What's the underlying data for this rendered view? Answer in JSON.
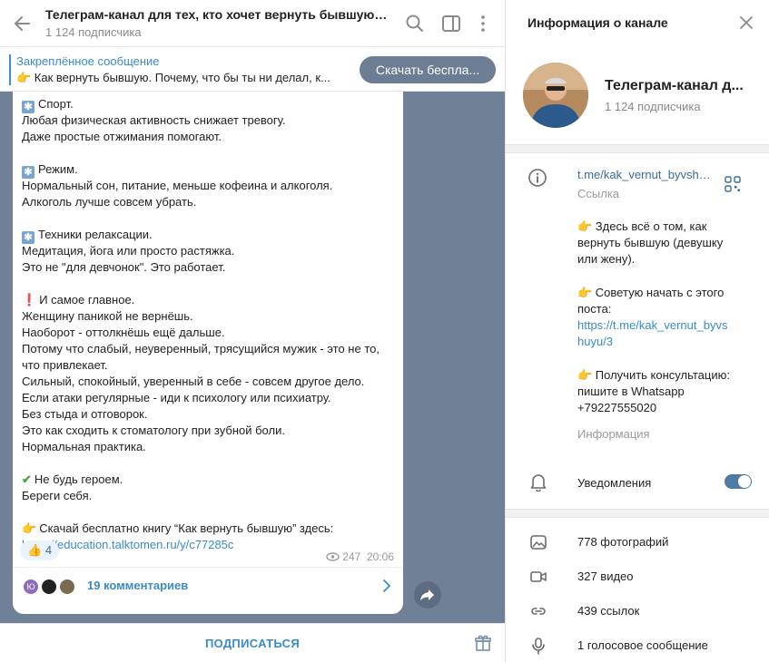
{
  "header": {
    "title": "Телеграм-канал для тех, кто хочет вернуть бывшую | Дм...",
    "subscribers": "1 124 подписчика"
  },
  "pinned": {
    "title": "Закреплённое сообщение",
    "text": "👉 Как вернуть бывшую.  Почему, что бы ты ни делал, к...",
    "button": "Скачать беспла..."
  },
  "message": {
    "lines": [
      {
        "icon": "box",
        "text": "Спорт."
      },
      {
        "text": "Любая физическая активность снижает тревогу."
      },
      {
        "text": "Даже простые отжимания помогают."
      },
      {
        "gap": true
      },
      {
        "icon": "box",
        "text": "Режим."
      },
      {
        "text": "Нормальный сон, питание, меньше кофеина и алкоголя."
      },
      {
        "text": "Алкоголь лучше совсем убрать."
      },
      {
        "gap": true
      },
      {
        "icon": "box",
        "text": "Техники релаксации."
      },
      {
        "text": "Медитация, йога или просто растяжка."
      },
      {
        "text": "Это не \"для девчонок\". Это работает."
      },
      {
        "gap": true
      },
      {
        "icon": "exclaim",
        "text": "И самое главное."
      },
      {
        "text": "Женщину паникой не вернёшь."
      },
      {
        "text": "Наоборот - оттолкнёшь ещё дальше."
      },
      {
        "text": "Потому что слабый, неуверенный, трясущийся мужик - это не то,"
      },
      {
        "text": "что привлекает."
      },
      {
        "text": "Сильный, спокойный, уверенный в себе - совсем другое дело."
      },
      {
        "text": "Если атаки регулярные - иди к психологу или психиатру."
      },
      {
        "text": "Без стыда и отговорок."
      },
      {
        "text": "Это как сходить к стоматологу при зубной боли."
      },
      {
        "text": "Нормальная практика."
      },
      {
        "gap": true
      },
      {
        "icon": "check",
        "text": "Не будь героем."
      },
      {
        "text": "Береги себя."
      },
      {
        "gap": true
      },
      {
        "icon": "hand",
        "text": "Скачай бесплатно книгу “Как вернуть бывшую” здесь:"
      }
    ],
    "link": "https://education.talktomen.ru/y/c77285c",
    "reaction_emoji": "👍",
    "reaction_count": "4",
    "views": "247",
    "time": "20:06",
    "comments": "19 комментариев",
    "avatar_initial": "Ю"
  },
  "bottom": {
    "subscribe": "ПОДПИСАТЬСЯ"
  },
  "right_panel": {
    "title": "Информация о канале",
    "channel_name": "Телеграм-канал д...",
    "subscribers": "1 124 подписчика",
    "link": "t.me/kak_vernut_byvshuyu",
    "link_label": "Ссылка",
    "description": [
      "👉 Здесь всё о том, как",
      "вернуть бывшую (девушку",
      "или жену).",
      "",
      "👉 Советую начать с этого",
      "поста:",
      "https://t.me/kak_vernut_byvs",
      "huyu/3",
      "",
      "👉 Получить консультацию:",
      "пишите в Whatsapp",
      "+79227555020"
    ],
    "description_label": "Информация",
    "notifications": "Уведомления",
    "notifications_on": true,
    "media": [
      {
        "icon": "photo-icon",
        "label": "778 фотографий"
      },
      {
        "icon": "video-icon",
        "label": "327 видео"
      },
      {
        "icon": "link-icon",
        "label": "439 ссылок"
      },
      {
        "icon": "microphone-icon",
        "label": "1 голосовое сообщение"
      }
    ]
  },
  "colors": {
    "accent": "#3a8bc9",
    "chat_background": "#708197",
    "pinned_button": "#6d7d93",
    "toggle": "#4e7aa6"
  }
}
